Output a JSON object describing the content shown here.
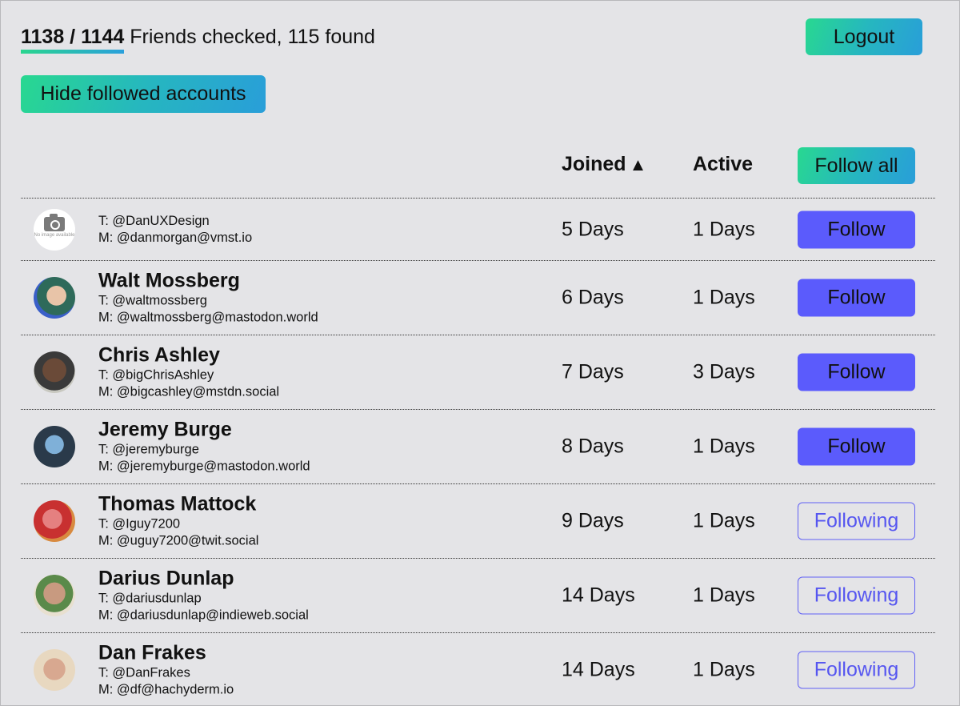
{
  "header": {
    "checked": "1138",
    "total": "1144",
    "counts_label": "1138 / 1144",
    "status_text": " Friends checked, 115 found",
    "progress_fraction": 0.9948,
    "logout_label": "Logout",
    "hide_followed_label": "Hide followed accounts"
  },
  "table": {
    "columns": {
      "joined": "Joined",
      "sort_indicator": "▲",
      "active": "Active",
      "follow_all_label": "Follow all"
    },
    "rows": [
      {
        "name": "",
        "twitter": "T: @DanUXDesign",
        "mastodon": "M: @danmorgan@vmst.io",
        "joined": "5 Days",
        "active": "1 Days",
        "action": "Follow",
        "avatar": "no-image",
        "avatar_text": "No image available"
      },
      {
        "name": "Walt Mossberg",
        "twitter": "T: @waltmossberg",
        "mastodon": "M: @waltmossberg@mastodon.world",
        "joined": "6 Days",
        "active": "1 Days",
        "action": "Follow",
        "avatar": "photo"
      },
      {
        "name": "Chris Ashley",
        "twitter": "T: @bigChrisAshley",
        "mastodon": "M: @bigcashley@mstdn.social",
        "joined": "7 Days",
        "active": "3 Days",
        "action": "Follow",
        "avatar": "photo"
      },
      {
        "name": "Jeremy Burge",
        "twitter": "T: @jeremyburge",
        "mastodon": "M: @jeremyburge@mastodon.world",
        "joined": "8 Days",
        "active": "1 Days",
        "action": "Follow",
        "avatar": "photo"
      },
      {
        "name": "Thomas Mattock",
        "twitter": "T: @Iguy7200",
        "mastodon": "M: @uguy7200@twit.social",
        "joined": "9 Days",
        "active": "1 Days",
        "action": "Following",
        "avatar": "photo"
      },
      {
        "name": "Darius Dunlap",
        "twitter": "T: @dariusdunlap",
        "mastodon": "M: @dariusdunlap@indieweb.social",
        "joined": "14 Days",
        "active": "1 Days",
        "action": "Following",
        "avatar": "photo"
      },
      {
        "name": "Dan Frakes",
        "twitter": "T: @DanFrakes",
        "mastodon": "M: @df@hachyderm.io",
        "joined": "14 Days",
        "active": "1 Days",
        "action": "Following",
        "avatar": "photo"
      }
    ]
  },
  "colors": {
    "background": "#e4e4e7",
    "gradient_start": "#28d890",
    "gradient_end": "#299ed9",
    "follow_button": "#5b5bfc",
    "following_outline": "#6060f5"
  }
}
